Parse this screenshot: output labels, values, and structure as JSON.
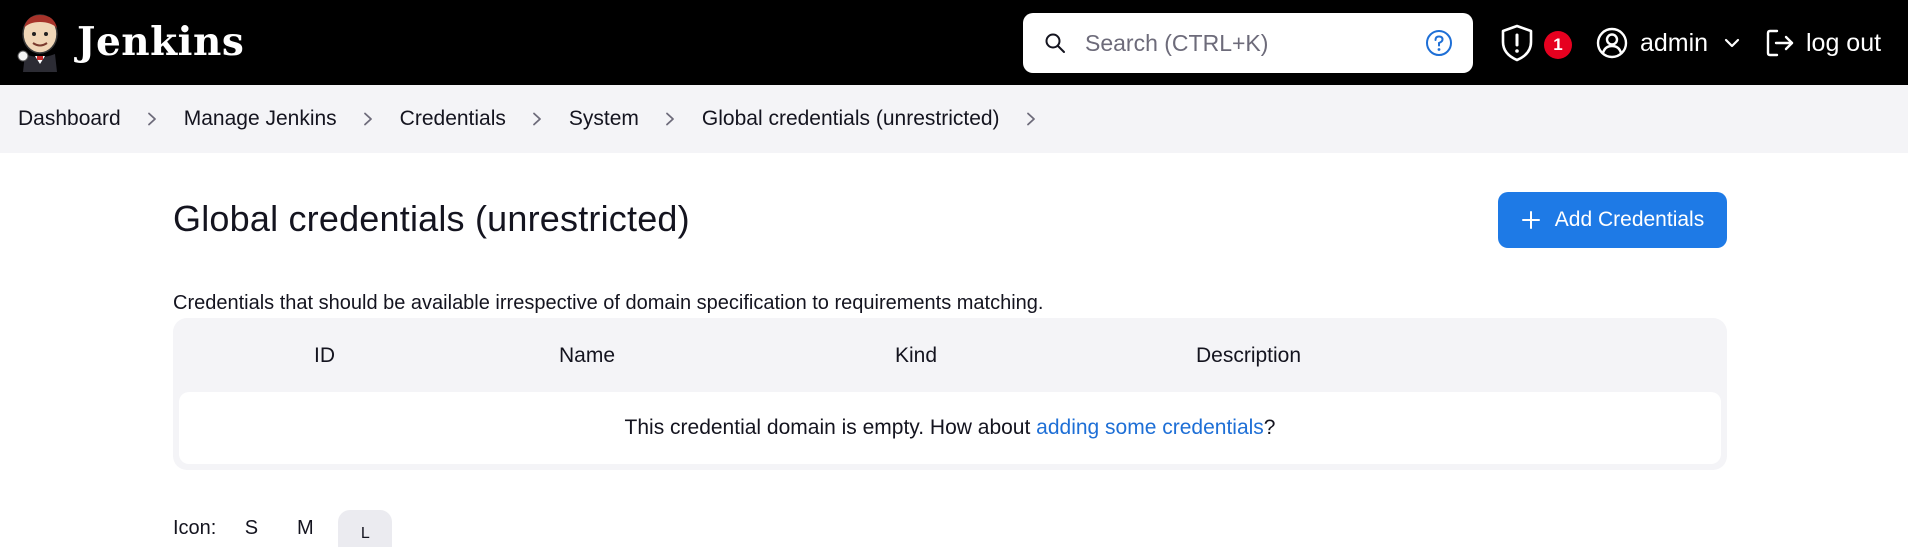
{
  "header": {
    "brand": "Jenkins",
    "search": {
      "placeholder": "Search (CTRL+K)",
      "value": ""
    },
    "security_badge_count": "1",
    "user": "admin",
    "logout": "log out",
    "colors": {
      "background": "#000000",
      "badge": "#e6001f"
    }
  },
  "breadcrumbs": [
    "Dashboard",
    "Manage Jenkins",
    "Credentials",
    "System",
    "Global credentials (unrestricted)"
  ],
  "main": {
    "title": "Global credentials (unrestricted)",
    "add_button": "Add Credentials",
    "description": "Credentials that should be available irrespective of domain specification to requirements matching.",
    "table": {
      "columns": [
        "ID",
        "Name",
        "Kind",
        "Description"
      ],
      "empty_prefix": "This credential domain is empty. How about ",
      "empty_link": "adding some credentials",
      "empty_suffix": "?"
    },
    "icon_size": {
      "label": "Icon:",
      "options": [
        "S",
        "M",
        "L"
      ],
      "selected": "L"
    },
    "colors": {
      "accent": "#1e7ae6",
      "link": "#1e6fd6"
    }
  }
}
